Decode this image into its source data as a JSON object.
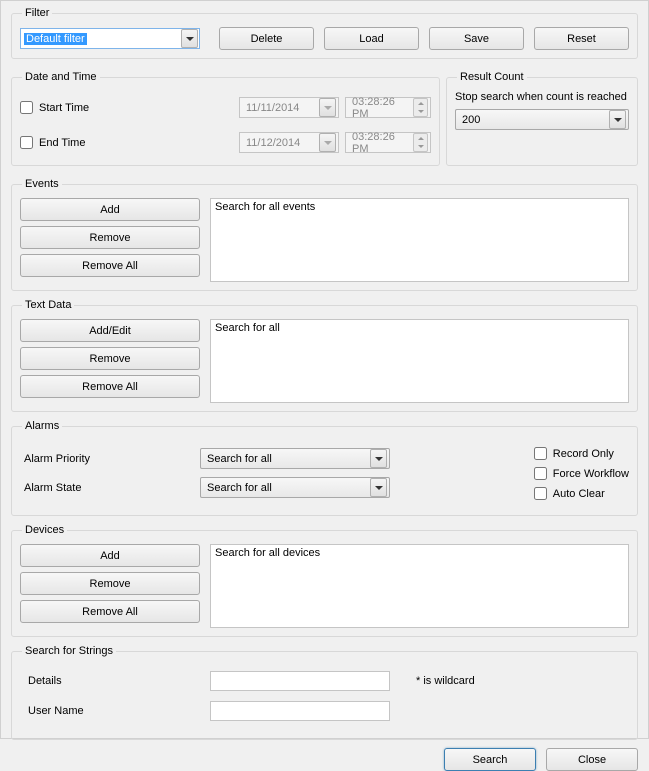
{
  "filter": {
    "legend": "Filter",
    "selected": "Default filter",
    "buttons": {
      "delete": "Delete",
      "load": "Load",
      "save": "Save",
      "reset": "Reset"
    }
  },
  "datetime": {
    "legend": "Date and Time",
    "start_label": "Start Time",
    "start_date": "11/11/2014",
    "start_time": "03:28:26 PM",
    "end_label": "End Time",
    "end_date": "11/12/2014",
    "end_time": "03:28:26 PM"
  },
  "result_count": {
    "legend": "Result Count",
    "text": "Stop search when count is reached",
    "value": "200"
  },
  "events": {
    "legend": "Events",
    "add": "Add",
    "remove": "Remove",
    "remove_all": "Remove All",
    "list_text": "Search for all events"
  },
  "textdata": {
    "legend": "Text Data",
    "addedit": "Add/Edit",
    "remove": "Remove",
    "remove_all": "Remove All",
    "list_text": "Search for all"
  },
  "alarms": {
    "legend": "Alarms",
    "priority_label": "Alarm Priority",
    "priority_value": "Search for all",
    "state_label": "Alarm State",
    "state_value": "Search for all",
    "record_only": "Record Only",
    "force_workflow": "Force Workflow",
    "auto_clear": "Auto Clear"
  },
  "devices": {
    "legend": "Devices",
    "add": "Add",
    "remove": "Remove",
    "remove_all": "Remove All",
    "list_text": "Search for all devices"
  },
  "strings": {
    "legend": "Search for Strings",
    "details_label": "Details",
    "details_value": "",
    "username_label": "User Name",
    "username_value": "",
    "wildcard_note": "* is wildcard"
  },
  "footer": {
    "search": "Search",
    "close": "Close"
  }
}
